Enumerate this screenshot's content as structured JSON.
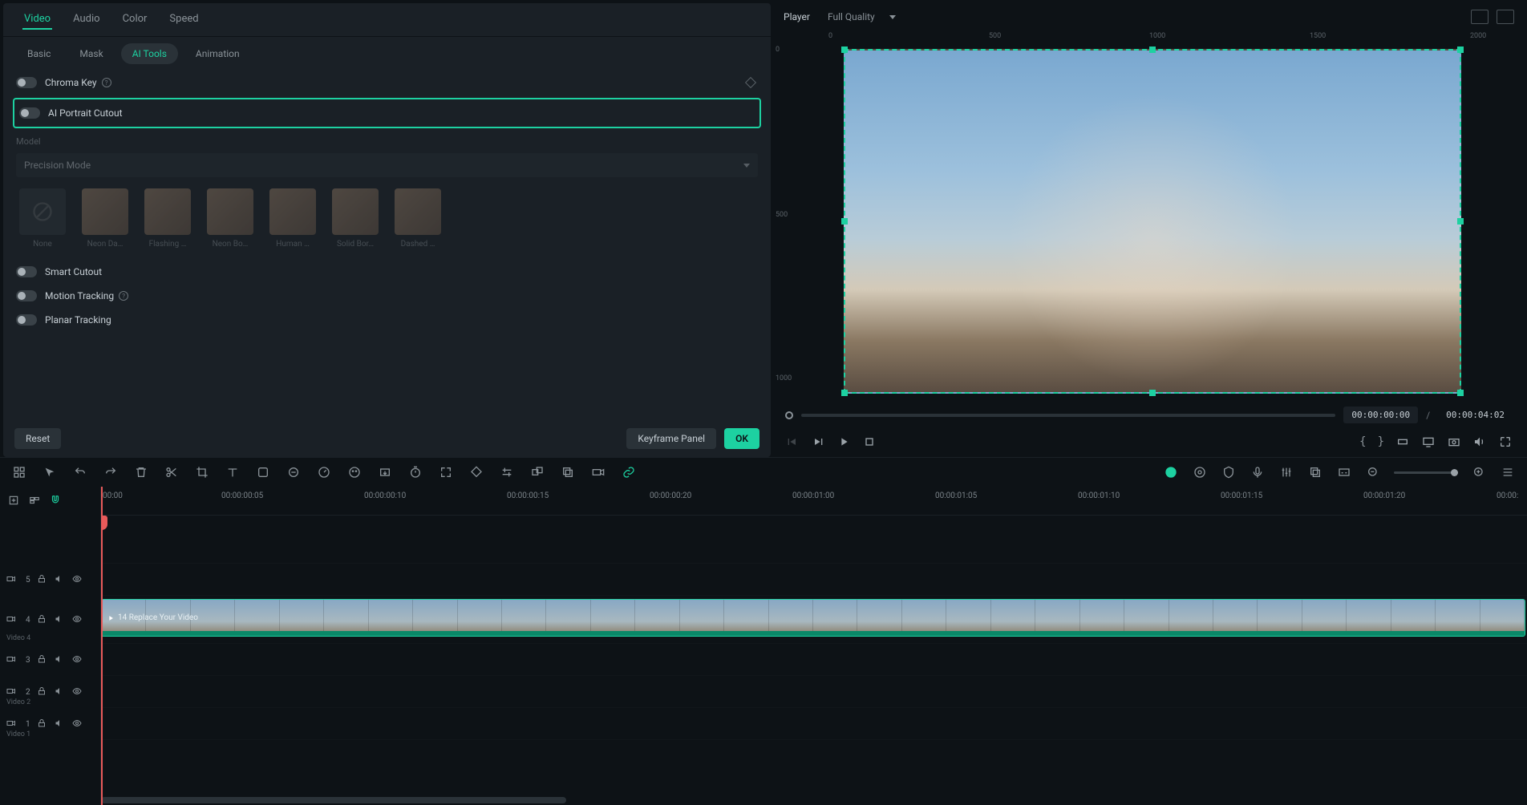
{
  "topTabs": {
    "items": [
      "Video",
      "Audio",
      "Color",
      "Speed"
    ],
    "active": 0
  },
  "subTabs": {
    "items": [
      "Basic",
      "Mask",
      "AI Tools",
      "Animation"
    ],
    "active": 2
  },
  "tools": {
    "chromaKey": "Chroma Key",
    "aiPortrait": "AI Portrait Cutout",
    "smartCutout": "Smart Cutout",
    "motionTracking": "Motion Tracking",
    "planarTracking": "Planar Tracking"
  },
  "model": {
    "label": "Model",
    "value": "Precision Mode"
  },
  "presets": [
    "None",
    "Neon Da…",
    "Flashing …",
    "Neon Bo…",
    "Human …",
    "Solid Bor…",
    "Dashed …"
  ],
  "footer": {
    "reset": "Reset",
    "keyframe": "Keyframe Panel",
    "ok": "OK"
  },
  "player": {
    "title": "Player",
    "quality": "Full Quality",
    "rulerH": [
      "0",
      "500",
      "1000",
      "1500",
      "2000"
    ],
    "rulerV": [
      "0",
      "500",
      "1000"
    ],
    "current": "00:00:00:00",
    "total": "00:00:04:02"
  },
  "timeRuler": [
    "00:00",
    "00:00:00:05",
    "00:00:00:10",
    "00:00:00:15",
    "00:00:00:20",
    "00:00:01:00",
    "00:00:01:05",
    "00:00:01:10",
    "00:00:01:15",
    "00:00:01:20",
    "00:00:"
  ],
  "tracks": [
    {
      "num": "5",
      "sub": ""
    },
    {
      "num": "4",
      "sub": "Video 4"
    },
    {
      "num": "3",
      "sub": ""
    },
    {
      "num": "2",
      "sub": "Video 2"
    },
    {
      "num": "1",
      "sub": "Video 1"
    }
  ],
  "clip": {
    "label": "14 Replace Your Video"
  }
}
